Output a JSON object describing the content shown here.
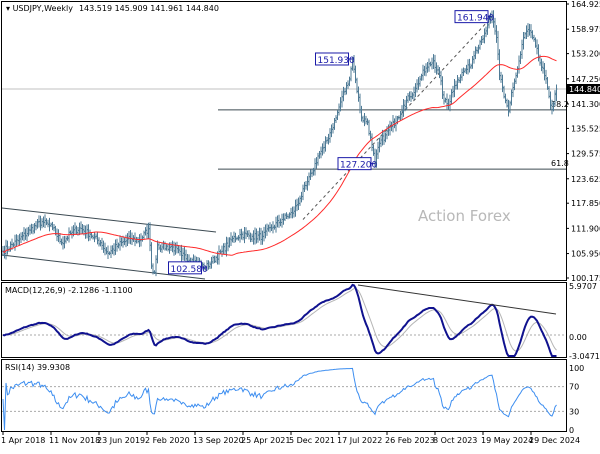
{
  "header": {
    "symbol_label": "USDJPY,Weekly",
    "ohlc": "143.519 145.909 141.961 144.840"
  },
  "watermark": "Action Forex",
  "macd": {
    "label": "MACD(12,26,9) -2.1286 -1.1100",
    "ticks": [
      "5.9707",
      "0.00",
      "-3.0471"
    ]
  },
  "rsi": {
    "label": "RSI(14) 39.9308",
    "ticks": [
      "100",
      "70",
      "30",
      "0"
    ]
  },
  "annotations": {
    "high1": "151.930",
    "high2": "161.940",
    "low1": "127.200",
    "low0": "102.580",
    "fib382": "38.2",
    "fib618": "61.8",
    "current_price": "144.840"
  },
  "colors": {
    "bars": "#4f7b96",
    "sma": "#ff2a2a",
    "macd": "#10128f",
    "signal": "#b5b5b5",
    "rsi": "#3d8ef0",
    "label_box": "#1a1aa8"
  },
  "chart_data": {
    "type": "ohlc",
    "title": "USDJPY,Weekly",
    "last_bar": {
      "open": 143.519,
      "high": 145.909,
      "low": 141.961,
      "close": 144.84
    },
    "price_ticks": [
      "164.925",
      "158.975",
      "153.200",
      "147.250",
      "141.300",
      "135.525",
      "129.575",
      "123.625",
      "117.850",
      "111.900",
      "105.950",
      "100.175"
    ],
    "ylim": [
      100.175,
      164.925
    ],
    "date_ticks": [
      "1 Apr 2018",
      "11 Nov 2018",
      "23 Jun 2019",
      "2 Feb 2020",
      "13 Sep 2020",
      "25 Apr 2021",
      "5 Dec 2021",
      "17 Jul 2022",
      "26 Feb 2023",
      "8 Oct 2023",
      "19 May 2024",
      "29 Dec 2024"
    ],
    "date_tick_weeks": [
      0,
      32,
      64,
      96,
      128,
      160,
      192,
      224,
      256,
      288,
      320,
      352
    ],
    "fib_levels": [
      {
        "name": "38.2",
        "price": 139.9
      },
      {
        "name": "61.8",
        "price": 125.9
      }
    ],
    "sma_period": 55,
    "close_keypoints_week_price": [
      [
        0,
        106.5
      ],
      [
        10,
        109
      ],
      [
        18,
        111.5
      ],
      [
        26,
        113.5
      ],
      [
        33,
        112
      ],
      [
        39,
        108.5
      ],
      [
        46,
        111
      ],
      [
        51,
        112
      ],
      [
        58,
        110.5
      ],
      [
        65,
        108.5
      ],
      [
        70,
        106
      ],
      [
        77,
        108
      ],
      [
        85,
        109.5
      ],
      [
        91,
        109
      ],
      [
        97,
        111.8
      ],
      [
        99,
        103
      ],
      [
        101,
        101.5
      ],
      [
        103,
        108
      ],
      [
        106,
        107.5
      ],
      [
        113,
        107.5
      ],
      [
        119,
        105.5
      ],
      [
        126,
        104.5
      ],
      [
        131,
        103.5
      ],
      [
        135,
        102.6
      ],
      [
        139,
        104
      ],
      [
        146,
        106.5
      ],
      [
        153,
        109.5
      ],
      [
        159,
        110.5
      ],
      [
        166,
        110
      ],
      [
        173,
        110
      ],
      [
        179,
        112
      ],
      [
        186,
        114
      ],
      [
        193,
        115.5
      ],
      [
        198,
        119
      ],
      [
        202,
        122
      ],
      [
        206,
        125
      ],
      [
        210,
        129
      ],
      [
        214,
        131
      ],
      [
        218,
        134.5
      ],
      [
        222,
        138
      ],
      [
        226,
        143
      ],
      [
        230,
        146
      ],
      [
        233,
        151.9
      ],
      [
        235,
        147
      ],
      [
        239,
        138
      ],
      [
        243,
        137
      ],
      [
        246,
        131
      ],
      [
        248,
        127.2
      ],
      [
        251,
        132
      ],
      [
        255,
        134
      ],
      [
        259,
        136
      ],
      [
        263,
        138
      ],
      [
        267,
        141
      ],
      [
        271,
        143
      ],
      [
        275,
        145
      ],
      [
        279,
        148
      ],
      [
        283,
        150
      ],
      [
        287,
        151.5
      ],
      [
        291,
        148
      ],
      [
        294,
        142
      ],
      [
        297,
        141
      ],
      [
        299,
        144
      ],
      [
        303,
        147
      ],
      [
        307,
        149
      ],
      [
        311,
        150
      ],
      [
        315,
        154
      ],
      [
        318,
        156
      ],
      [
        321,
        158
      ],
      [
        323,
        160
      ],
      [
        326,
        161.9
      ],
      [
        329,
        157
      ],
      [
        331,
        148
      ],
      [
        334,
        143
      ],
      [
        337,
        139.6
      ],
      [
        339,
        144
      ],
      [
        342,
        148
      ],
      [
        345,
        153
      ],
      [
        347,
        157
      ],
      [
        350,
        158.9
      ],
      [
        353,
        157
      ],
      [
        355,
        155
      ],
      [
        358,
        151
      ],
      [
        361,
        148
      ],
      [
        363,
        145
      ],
      [
        366,
        140
      ],
      [
        369,
        144.84
      ]
    ]
  }
}
